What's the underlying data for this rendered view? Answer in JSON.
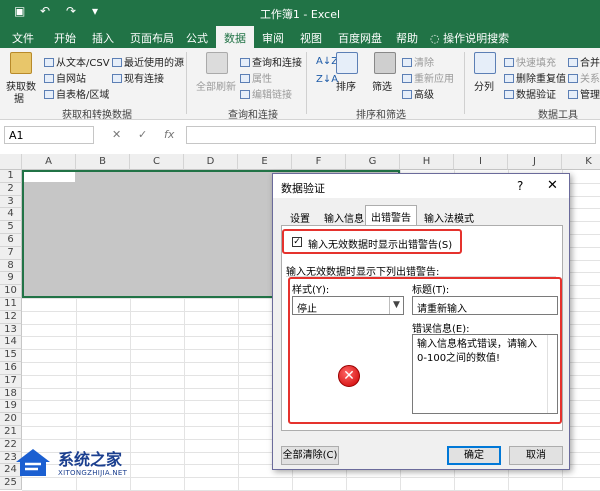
{
  "window": {
    "title": "工作簿1 - Excel"
  },
  "ribbon_tabs": [
    "文件",
    "开始",
    "插入",
    "页面布局",
    "公式",
    "数据",
    "审阅",
    "视图",
    "百度网盘",
    "帮助"
  ],
  "active_tab": "数据",
  "tell_me": "操作说明搜索",
  "ribbon": {
    "get_data": "获取数",
    "get_data_sub": "据",
    "from_text": "从文本/CSV",
    "from_web": "自网站",
    "from_table": "自表格/区域",
    "recent_sources": "最近使用的源",
    "existing_conn": "现有连接",
    "group_get": "获取和转换数据",
    "refresh_all": "全部刷新",
    "queries_conn": "查询和连接",
    "properties": "属性",
    "edit_links": "编辑链接",
    "group_query": "查询和连接",
    "sort": "排序",
    "filter": "筛选",
    "clear": "清除",
    "reapply": "重新应用",
    "advanced": "高级",
    "group_sort": "排序和筛选",
    "text_to_columns": "分列",
    "flash_fill": "快速填充",
    "remove_dup": "删除重复值",
    "data_validation": "数据验证",
    "consolidate": "合并",
    "relationships": "关系",
    "manage": "管理",
    "group_tools": "数据工具"
  },
  "formula_bar": {
    "name_box": "A1",
    "cancel": "✕",
    "enter": "✓",
    "fx": "fx"
  },
  "columns": [
    "A",
    "B",
    "C",
    "D",
    "E",
    "F",
    "G",
    "H",
    "I",
    "J",
    "K"
  ],
  "rows": [
    "1",
    "2",
    "3",
    "4",
    "5",
    "6",
    "7",
    "8",
    "9",
    "10",
    "11",
    "12",
    "13",
    "14",
    "15",
    "16",
    "17",
    "18",
    "19",
    "20",
    "21",
    "22",
    "23",
    "24",
    "25"
  ],
  "dialog": {
    "title": "数据验证",
    "help": "?",
    "close": "✕",
    "tabs": [
      "设置",
      "输入信息",
      "出错警告",
      "输入法模式"
    ],
    "active_tab": "出错警告",
    "show_error_check": "输入无效数据时显示出错警告(S)",
    "section_label": "输入无效数据时显示下列出错警告:",
    "style_label": "样式(Y):",
    "style_value": "停止",
    "title_label": "标题(T):",
    "title_value": "请重新输入",
    "message_label": "错误信息(E):",
    "message_value": "输入信息格式错误，请输入0-100之间的数值!",
    "clear_all": "全部清除(C)",
    "ok": "确定",
    "cancel": "取消"
  },
  "watermark": {
    "name": "系统之家",
    "url": "XITONGZHIJIA.NET"
  },
  "colors": {
    "excel_green": "#217346",
    "highlight_red": "#e5322d"
  }
}
